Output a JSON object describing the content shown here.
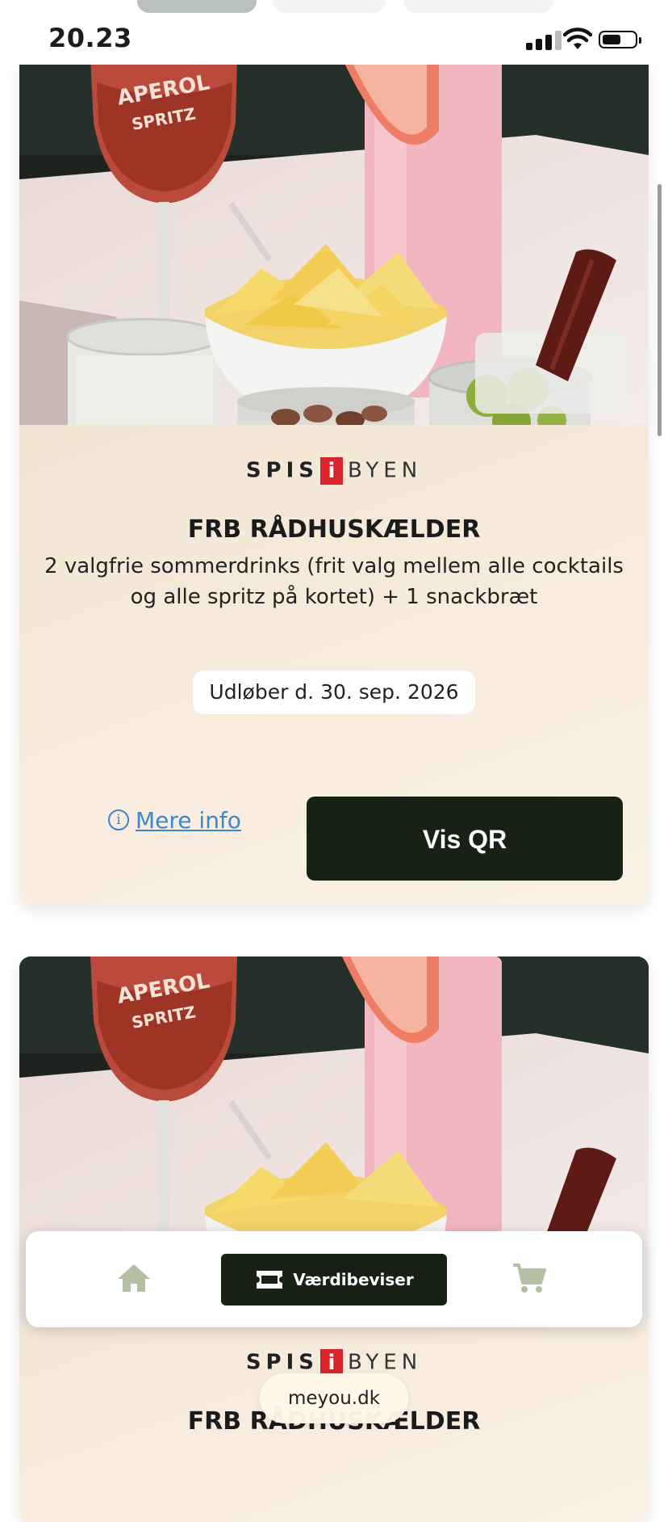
{
  "status_bar": {
    "time": "20.23"
  },
  "vouchers": [
    {
      "brand": {
        "spis": "SPIS",
        "i": "i",
        "byen": "BYEN"
      },
      "venue": "FRB RÅDHUSKÆLDER",
      "description": "2 valgfrie sommerdrinks (frit valg mellem alle cocktails og alle spritz på kortet) + 1 snackbræt",
      "expiry": "Udløber d. 30. sep. 2026",
      "more_info_label": "Mere info",
      "qr_button_label": "Vis QR",
      "photo_glass_text": [
        "APEROL",
        "SPRITZ"
      ]
    },
    {
      "brand": {
        "spis": "SPIS",
        "i": "i",
        "byen": "BYEN"
      },
      "venue": "FRB RÅDHUSKÆLDER",
      "photo_glass_text": [
        "APEROL",
        "SPRITZ"
      ]
    }
  ],
  "bottom_nav": {
    "active_label": "Værdibeviser",
    "items": [
      "home-icon",
      "voucher-icon",
      "cart-icon"
    ]
  },
  "browser": {
    "url": "meyou.dk"
  },
  "colors": {
    "primary_dark": "#172114",
    "link_blue": "#3a88cf",
    "brand_red": "#d8232a",
    "nav_icon": "#b5bfa2"
  }
}
